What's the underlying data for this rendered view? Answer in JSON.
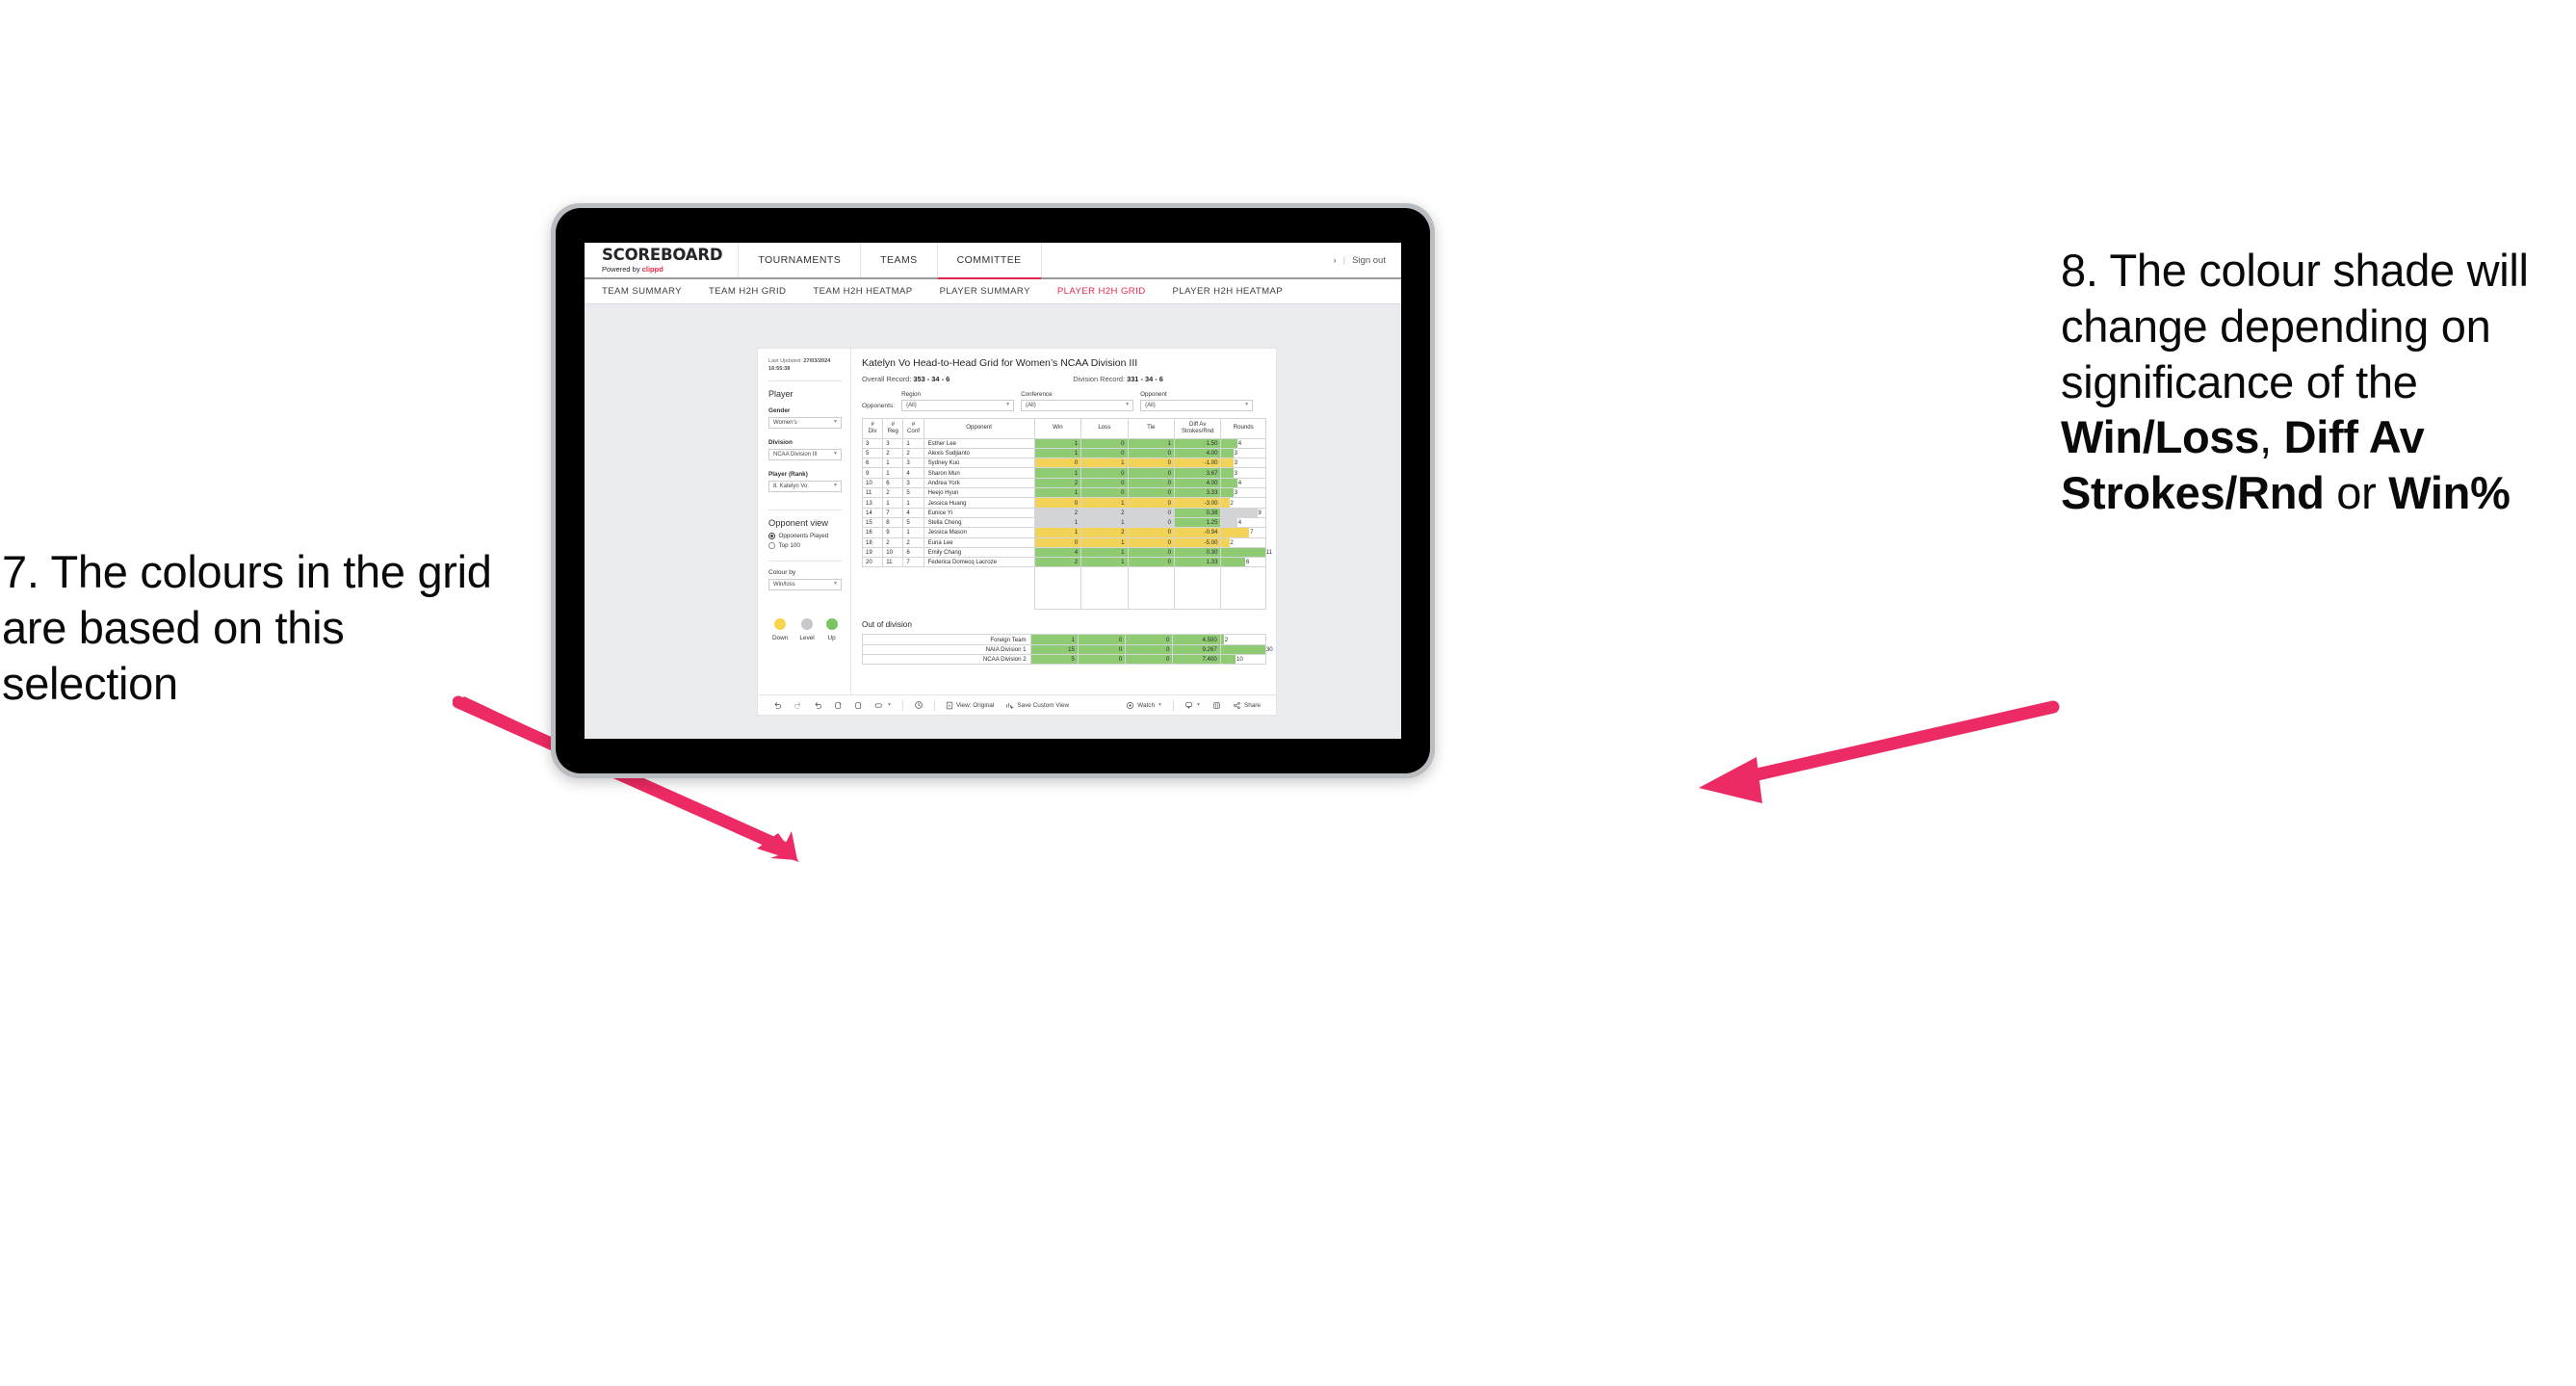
{
  "annotations": {
    "left": "7. The colours in the grid are based on this selection",
    "right_pre": "8. The colour shade will change depending on significance of the ",
    "right_b1": "Win/Loss",
    "right_mid1": ", ",
    "right_b2": "Diff Av Strokes/Rnd",
    "right_mid2": " or ",
    "right_b3": "Win%",
    "arrow_color": "#ec2a63"
  },
  "header": {
    "brand_name": "SCOREBOARD",
    "brand_sub_prefix": "Powered by ",
    "brand_sub_accent": "clippd",
    "nav": [
      {
        "label": "TOURNAMENTS",
        "active": false
      },
      {
        "label": "TEAMS",
        "active": false
      },
      {
        "label": "COMMITTEE",
        "active": true
      }
    ],
    "chevron": "›",
    "divider": "|",
    "sign_out": "Sign out",
    "accent": "#e0244c"
  },
  "subnav": [
    {
      "label": "TEAM SUMMARY",
      "active": false
    },
    {
      "label": "TEAM H2H GRID",
      "active": false
    },
    {
      "label": "TEAM H2H HEATMAP",
      "active": false
    },
    {
      "label": "PLAYER SUMMARY",
      "active": false
    },
    {
      "label": "PLAYER H2H GRID",
      "active": true
    },
    {
      "label": "PLAYER H2H HEATMAP",
      "active": false
    }
  ],
  "sidebar": {
    "last_updated_label": "Last Updated: ",
    "last_updated_value": "27/03/2024",
    "last_updated_time": "16:55:38",
    "player_heading": "Player",
    "gender_label": "Gender",
    "gender_value": "Women’s",
    "division_label": "Division",
    "division_value": "NCAA Division III",
    "player_rank_label": "Player (Rank)",
    "player_rank_value": "8. Katelyn Vo",
    "opponent_view_heading": "Opponent view",
    "opponent_view_options": [
      {
        "label": "Opponents Played",
        "selected": true
      },
      {
        "label": "Top 100",
        "selected": false
      }
    ],
    "colour_by_label": "Colour by",
    "colour_by_value": "Win/loss",
    "legend": [
      {
        "label": "Down",
        "color": "#f5d54e"
      },
      {
        "label": "Level",
        "color": "#c6c8cb"
      },
      {
        "label": "Up",
        "color": "#77c460"
      }
    ]
  },
  "main": {
    "title": "Katelyn Vo Head-to-Head Grid for Women’s NCAA Division III",
    "overall_record_label": "Overall Record: ",
    "overall_record_value": "353 -  34 - 6",
    "division_record_label": "Division Record: ",
    "division_record_value": "331 -  34 - 6",
    "opponents_label": "Opponents:",
    "filters": [
      {
        "label": "Region",
        "value": "(All)"
      },
      {
        "label": "Conference",
        "value": "(All)"
      },
      {
        "label": "Opponent",
        "value": "(All)"
      }
    ],
    "out_of_division_title": "Out of division"
  },
  "chart_data": {
    "type": "table",
    "title": "Katelyn Vo Head-to-Head Grid for Women’s NCAA Division III",
    "columns": [
      "# Div",
      "# Reg",
      "# Conf",
      "Opponent",
      "Win",
      "Loss",
      "Tie",
      "Diff Av Strokes/Rnd",
      "Rounds"
    ],
    "column_header_lines": [
      [
        "#",
        "Div"
      ],
      [
        "#",
        "Reg"
      ],
      [
        "#",
        "Conf"
      ],
      [
        "Opponent"
      ],
      [
        "Win"
      ],
      [
        "Loss"
      ],
      [
        "Tie"
      ],
      [
        "Diff Av",
        "Strokes/Rnd"
      ],
      [
        "Rounds"
      ]
    ],
    "colour_by": "Win/loss",
    "colours": {
      "up": "#8fcb72",
      "down": "#f2d357",
      "level": "#d2d4d6"
    },
    "rounds_max": 11,
    "rows": [
      {
        "div": "3",
        "reg": "3",
        "conf": "1",
        "opponent": "Esther Lee",
        "win": "1",
        "loss": "0",
        "tie": "1",
        "diff": "1.50",
        "rounds": "4",
        "state": "up",
        "diff_state": "up"
      },
      {
        "div": "5",
        "reg": "2",
        "conf": "2",
        "opponent": "Alexis Sudjianto",
        "win": "1",
        "loss": "0",
        "tie": "0",
        "diff": "4.00",
        "rounds": "3",
        "state": "up",
        "diff_state": "up"
      },
      {
        "div": "6",
        "reg": "1",
        "conf": "3",
        "opponent": "Sydney Kuo",
        "win": "0",
        "loss": "1",
        "tie": "0",
        "diff": "-1.00",
        "rounds": "3",
        "state": "down",
        "diff_state": "down"
      },
      {
        "div": "9",
        "reg": "1",
        "conf": "4",
        "opponent": "Sharon Mun",
        "win": "1",
        "loss": "0",
        "tie": "0",
        "diff": "3.67",
        "rounds": "3",
        "state": "up",
        "diff_state": "up"
      },
      {
        "div": "10",
        "reg": "6",
        "conf": "3",
        "opponent": "Andrea York",
        "win": "2",
        "loss": "0",
        "tie": "0",
        "diff": "4.00",
        "rounds": "4",
        "state": "up",
        "diff_state": "up"
      },
      {
        "div": "11",
        "reg": "2",
        "conf": "5",
        "opponent": "Heejo Hyun",
        "win": "1",
        "loss": "0",
        "tie": "0",
        "diff": "3.33",
        "rounds": "3",
        "state": "up",
        "diff_state": "up"
      },
      {
        "div": "13",
        "reg": "1",
        "conf": "1",
        "opponent": "Jessica Huang",
        "win": "0",
        "loss": "1",
        "tie": "0",
        "diff": "-3.00",
        "rounds": "2",
        "state": "down",
        "diff_state": "down"
      },
      {
        "div": "14",
        "reg": "7",
        "conf": "4",
        "opponent": "Eunice Yi",
        "win": "2",
        "loss": "2",
        "tie": "0",
        "diff": "0.38",
        "rounds": "9",
        "state": "level",
        "diff_state": "up"
      },
      {
        "div": "15",
        "reg": "8",
        "conf": "5",
        "opponent": "Stella Cheng",
        "win": "1",
        "loss": "1",
        "tie": "0",
        "diff": "1.25",
        "rounds": "4",
        "state": "level",
        "diff_state": "up"
      },
      {
        "div": "16",
        "reg": "9",
        "conf": "1",
        "opponent": "Jessica Mason",
        "win": "1",
        "loss": "2",
        "tie": "0",
        "diff": "-0.94",
        "rounds": "7",
        "state": "down",
        "diff_state": "down"
      },
      {
        "div": "18",
        "reg": "2",
        "conf": "2",
        "opponent": "Euna Lee",
        "win": "0",
        "loss": "1",
        "tie": "0",
        "diff": "-5.00",
        "rounds": "2",
        "state": "down",
        "diff_state": "down"
      },
      {
        "div": "19",
        "reg": "10",
        "conf": "6",
        "opponent": "Emily Chang",
        "win": "4",
        "loss": "1",
        "tie": "0",
        "diff": "0.30",
        "rounds": "11",
        "state": "up",
        "diff_state": "up"
      },
      {
        "div": "20",
        "reg": "11",
        "conf": "7",
        "opponent": "Federica Domecq Lacroze",
        "win": "2",
        "loss": "1",
        "tie": "0",
        "diff": "1.33",
        "rounds": "6",
        "state": "up",
        "diff_state": "up"
      }
    ],
    "out_of_division": {
      "rounds_max": 30,
      "rows": [
        {
          "name": "Foreign Team",
          "win": "1",
          "loss": "0",
          "tie": "0",
          "diff": "4.500",
          "rounds": "2",
          "state": "up"
        },
        {
          "name": "NAIA Division 1",
          "win": "15",
          "loss": "0",
          "tie": "0",
          "diff": "9.267",
          "rounds": "30",
          "state": "up"
        },
        {
          "name": "NCAA Division 2",
          "win": "5",
          "loss": "0",
          "tie": "0",
          "diff": "7.400",
          "rounds": "10",
          "state": "up"
        }
      ]
    }
  },
  "toolbar": {
    "view_label": "View: Original",
    "save_label": "Save Custom View",
    "watch_label": "Watch",
    "share_label": "Share"
  }
}
